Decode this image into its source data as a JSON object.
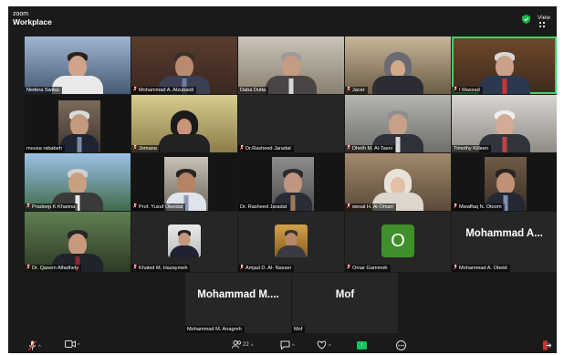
{
  "app": {
    "brand_line1": "zoom",
    "brand_line2": "Workplace",
    "view_label": "View"
  },
  "colors": {
    "accent_green": "#3bd46b",
    "share_green": "#15c15c",
    "letter_avatar_bg": "#3f8f2a"
  },
  "tiles": [
    {
      "name": "Nedera Swiiss",
      "muted": false
    },
    {
      "name": "Mohammad A. Alzubaidi",
      "muted": true
    },
    {
      "name": "Daba Dutta",
      "muted": false
    },
    {
      "name": "Jacer",
      "muted": true
    },
    {
      "name": "I Massad",
      "muted": true
    },
    {
      "name": "mousa rababeh",
      "muted": false
    },
    {
      "name": "Jomana",
      "muted": true
    },
    {
      "name": "Dr.Rasheed Jaradat",
      "muted": true
    },
    {
      "name": "Dheth M. Al-Tasni",
      "muted": true
    },
    {
      "name": "Timothy Killeen",
      "muted": false
    },
    {
      "name": "Pradeep K Khanna",
      "muted": true
    },
    {
      "name": "Prof. Yusuf Obeidat",
      "muted": true
    },
    {
      "name": "Dr. Rasheed Jaradat",
      "muted": false
    },
    {
      "name": "wesal H. Al-Omari",
      "muted": true
    },
    {
      "name": "Mwaffaq N. Otoom",
      "muted": true
    },
    {
      "name": "Dr. Qasem Alfadhely",
      "muted": true
    },
    {
      "name": "Khaled M. Hazaymeh",
      "muted": true
    },
    {
      "name": "Amjad D. Al- Nasser",
      "muted": true
    },
    {
      "name": "Omar Gammoh",
      "muted": true
    },
    {
      "name": "Mohammad A. Obeid",
      "muted": true
    },
    {
      "name": "Mohammad M. Anagreh",
      "muted": false
    },
    {
      "name": "Mof",
      "muted": false
    }
  ],
  "name_cards": {
    "mohammad_a": "Mohammad  A...",
    "mohammad_m": "Mohammad  M....",
    "mof": "Mof"
  },
  "letter_avatar": {
    "letter": "O"
  },
  "toolbar": {
    "participants_count": "22"
  }
}
